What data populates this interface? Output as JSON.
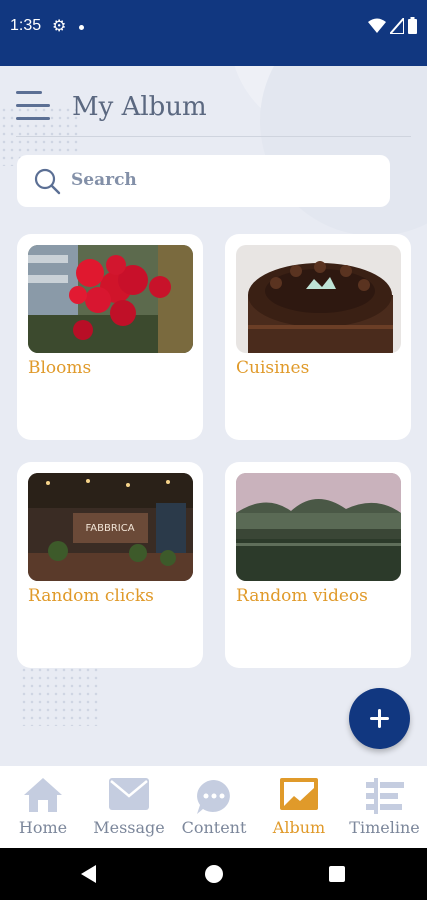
{
  "status_bar": {
    "time": "1:35"
  },
  "header": {
    "title": "My Album"
  },
  "search": {
    "placeholder": "Search"
  },
  "albums": [
    {
      "label": "Blooms"
    },
    {
      "label": "Cuisines"
    },
    {
      "label": "Random clicks"
    },
    {
      "label": "Random videos"
    }
  ],
  "bottom_nav": {
    "items": [
      {
        "label": "Home",
        "icon": "home-icon"
      },
      {
        "label": "Message",
        "icon": "message-icon"
      },
      {
        "label": "Content",
        "icon": "chat-bubble-icon"
      },
      {
        "label": "Album",
        "icon": "album-icon",
        "active": true
      },
      {
        "label": "Timeline",
        "icon": "timeline-icon"
      }
    ]
  },
  "colors": {
    "primary": "#113780",
    "accent": "#e09a2a",
    "background": "#e8ebf3",
    "nav_inactive": "#7c879b"
  }
}
